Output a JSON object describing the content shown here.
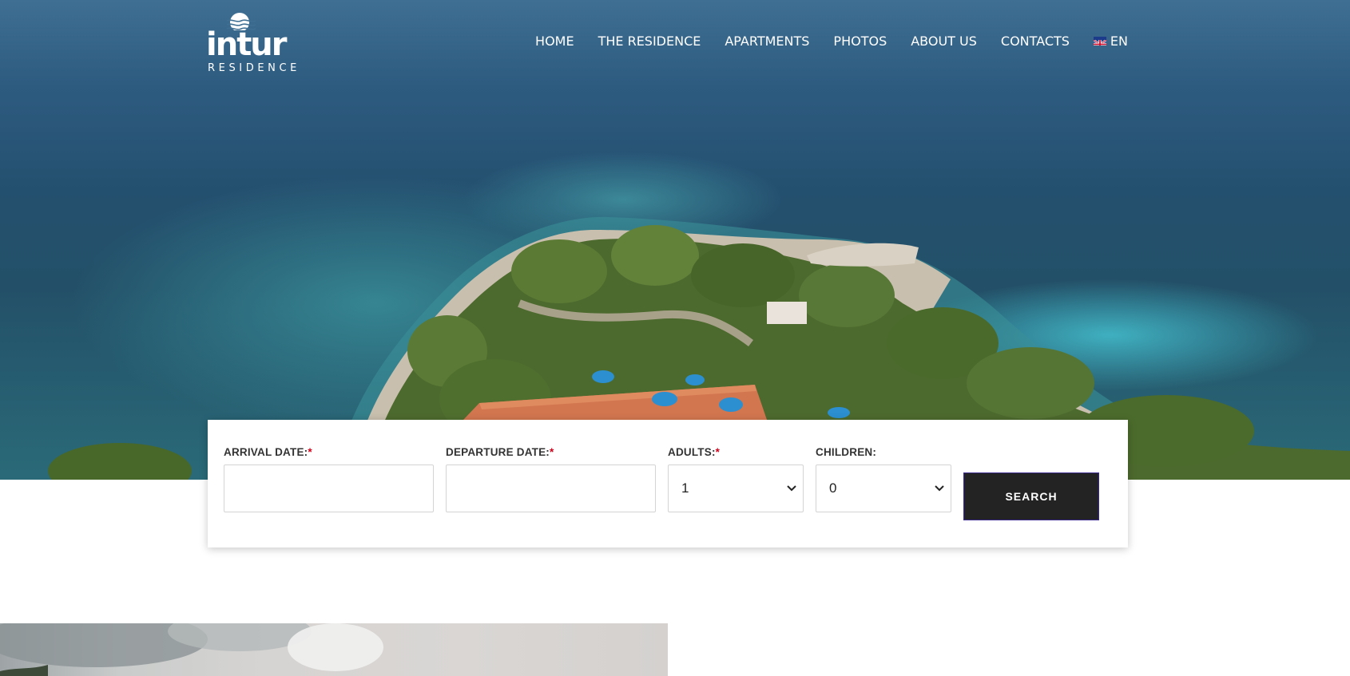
{
  "brand": {
    "name": "intur",
    "subtitle": "RESIDENCE"
  },
  "nav": {
    "items": [
      {
        "label": "HOME"
      },
      {
        "label": "THE RESIDENCE"
      },
      {
        "label": "APARTMENTS"
      },
      {
        "label": "PHOTOS"
      },
      {
        "label": "ABOUT US"
      },
      {
        "label": "CONTACTS"
      }
    ],
    "language": "EN"
  },
  "booking": {
    "arrival": {
      "label": "ARRIVAL DATE:",
      "required": "*",
      "value": ""
    },
    "departure": {
      "label": "DEPARTURE DATE:",
      "required": "*",
      "value": ""
    },
    "adults": {
      "label": "ADULTS:",
      "required": "*",
      "value": "1"
    },
    "children": {
      "label": "CHILDREN:",
      "value": "0"
    },
    "search_label": "SEARCH"
  },
  "colors": {
    "search_button": "#232323",
    "required_mark": "#d0021b"
  }
}
